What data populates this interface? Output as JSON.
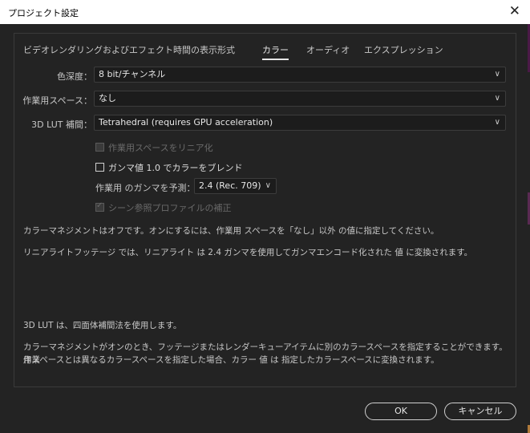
{
  "window": {
    "title": "プロジェクト設定",
    "close_glyph": "✕"
  },
  "tabs": [
    {
      "label": "ビデオレンダリングおよびエフェクト",
      "active": false
    },
    {
      "label": "時間の表示形式",
      "active": false
    },
    {
      "label": "カラー",
      "active": true
    },
    {
      "label": "オーディオ",
      "active": false
    },
    {
      "label": "エクスプレッション",
      "active": false
    }
  ],
  "settings": {
    "color_depth": {
      "label": "色深度：",
      "value": "8 bit/チャンネル"
    },
    "working_space": {
      "label": "作業用スペース：",
      "value": "なし"
    },
    "lut_interpolation": {
      "label": "3D LUT 補間：",
      "value": "Tetrahedral (requires GPU acceleration)"
    },
    "linearize": {
      "label": "作業用スペースをリニア化",
      "checked": false,
      "enabled": false
    },
    "blend_gamma": {
      "label": "ガンマ値 1.0 でカラーをブレンド",
      "checked": false,
      "enabled": true
    },
    "working_gamma": {
      "label": "作業用 のガンマを予測：",
      "value": "2.4 (Rec. 709)"
    },
    "scene_referred": {
      "label": "シーン参照プロファイルの補正",
      "checked": true,
      "enabled": false
    }
  },
  "info": {
    "line1": "カラーマネジメントはオフです。オンにするには、作業用 スペースを「なし」以外 の値に指定してください。",
    "line2": "リニアライトフッテージ では、リニアライト は 2.4 ガンマを使用してガンマエンコード化された 値 に変換されます。",
    "line3": "3D LUT は、四面体補間法を使用します。",
    "line4a": "カラーマネジメントがオンのとき、フッテージまたはレンダーキューアイテムに別のカラースペースを指定することができます。作業",
    "line4b": "用スペースとは異なるカラースペースを指定した場合、カラー 値 は 指定したカラースペースに変換されます。"
  },
  "buttons": {
    "ok": "OK",
    "cancel": "キャンセル"
  },
  "icons": {
    "chevron": "chevron-down-icon",
    "check": "checkmark-icon",
    "close": "close-icon"
  },
  "colors": {
    "background": "#232323",
    "titlebar": "#ffffff",
    "text": "#c8c8c8",
    "border": "#3a3a3a"
  }
}
